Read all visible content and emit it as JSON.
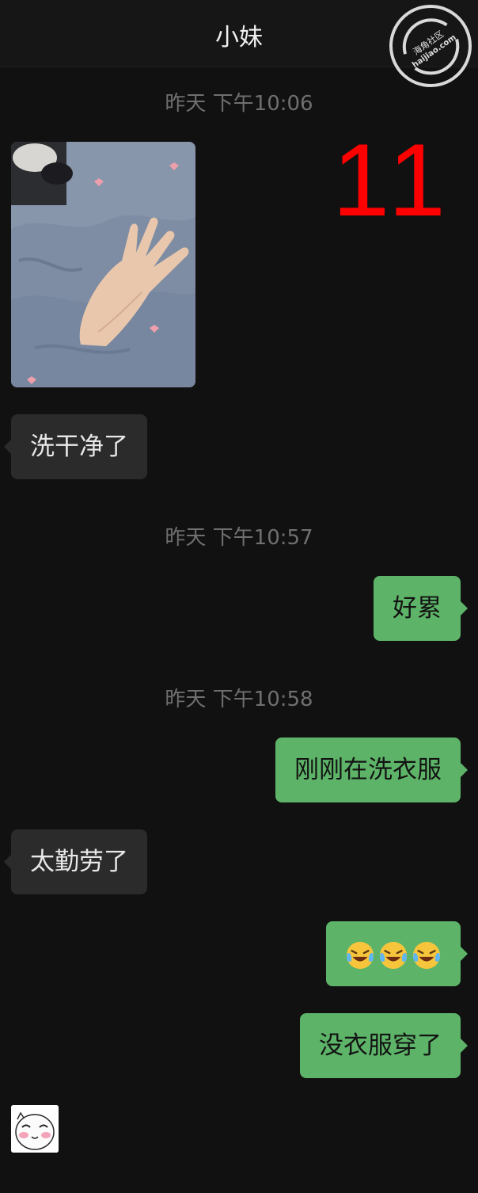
{
  "header": {
    "title": "小妹"
  },
  "watermark": {
    "text_cn": "海角社区",
    "text_en": "haijiao.com"
  },
  "overlay": {
    "number": "11",
    "color": "#ff0000"
  },
  "messages": [
    {
      "type": "timestamp",
      "text": "昨天 下午10:06"
    },
    {
      "type": "image",
      "side": "left",
      "icon": "photo-hand-on-blanket"
    },
    {
      "type": "text",
      "side": "left",
      "text": "洗干净了"
    },
    {
      "type": "timestamp",
      "text": "昨天 下午10:57"
    },
    {
      "type": "text",
      "side": "right",
      "text": "好累"
    },
    {
      "type": "timestamp",
      "text": "昨天 下午10:58"
    },
    {
      "type": "text",
      "side": "right",
      "text": "刚刚在洗衣服"
    },
    {
      "type": "text",
      "side": "left",
      "text": "太勤劳了"
    },
    {
      "type": "emoji",
      "side": "right",
      "icon": "laughing-crying-emoji",
      "count": 3
    },
    {
      "type": "text",
      "side": "right",
      "text": "没衣服穿了"
    },
    {
      "type": "sticker",
      "side": "left",
      "icon": "blushing-face-sticker"
    }
  ],
  "colors": {
    "background": "#111111",
    "received_bubble": "#2b2b2b",
    "sent_bubble": "#5db468",
    "timestamp": "#6f6f6f"
  }
}
